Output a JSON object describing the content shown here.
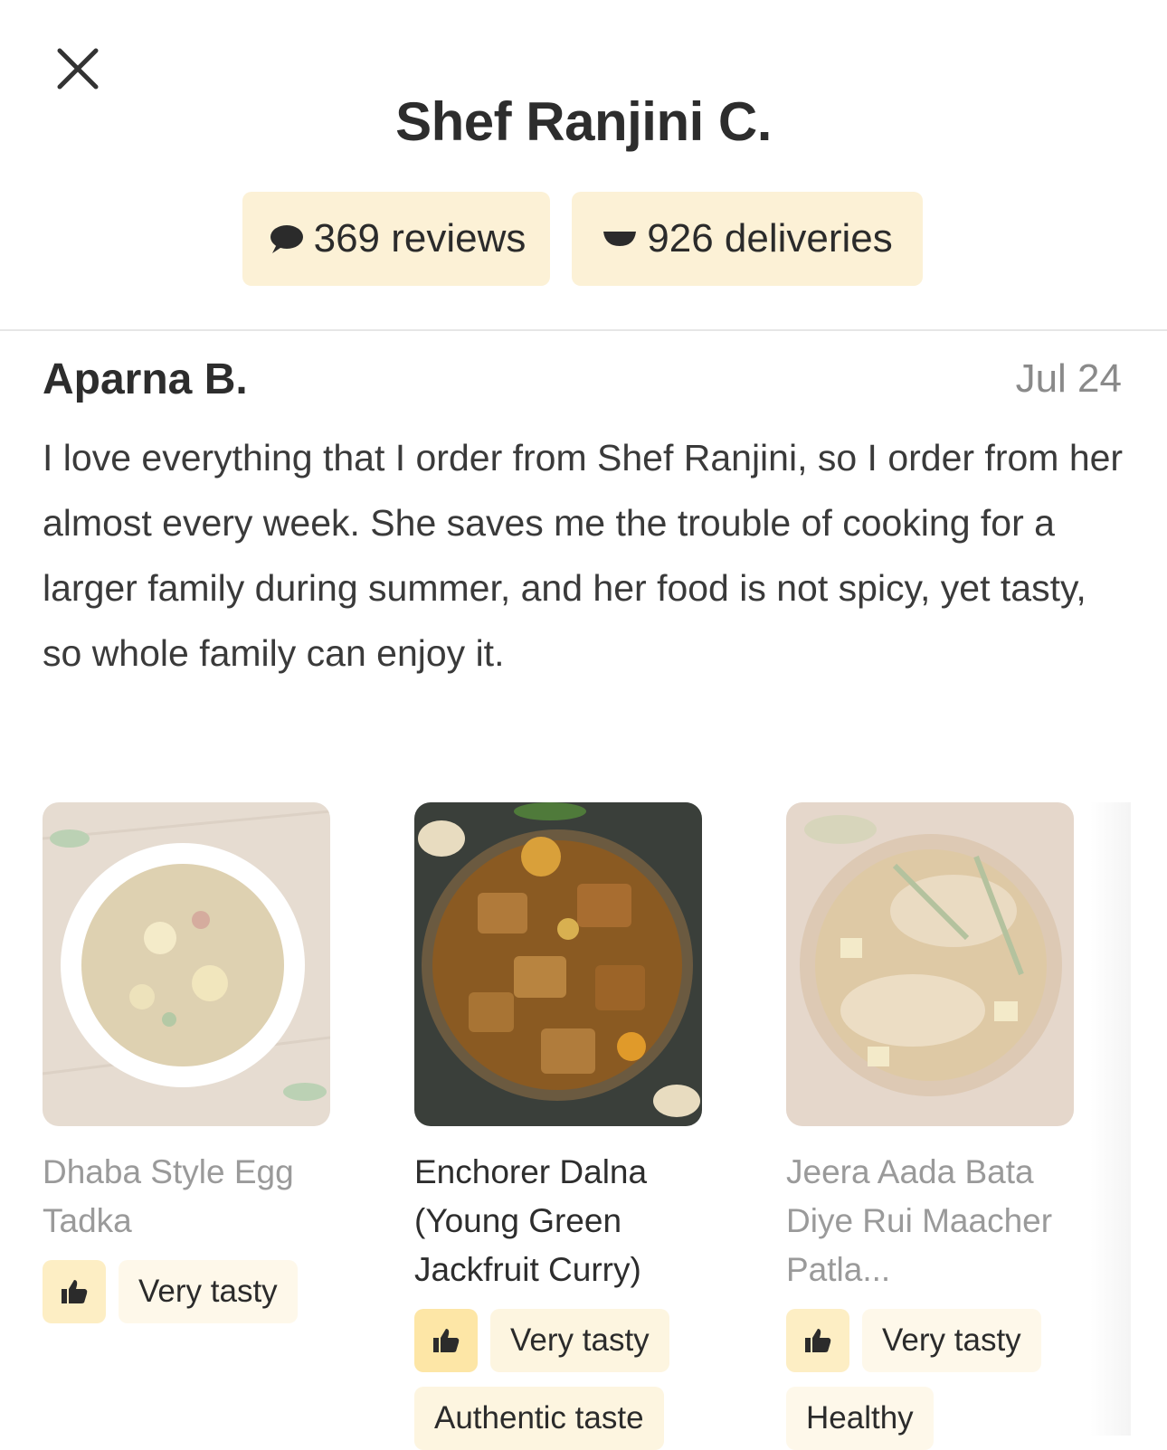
{
  "header": {
    "close_icon": "close-icon",
    "title": "Shef Ranjini C.",
    "reviews": "369 reviews",
    "deliveries": "926 deliveries"
  },
  "review": {
    "author": "Aparna B.",
    "date": "Jul 24",
    "text": "I love everything that I order from Shef Ranjini, so I order from her almost every week. She saves me the trouble of cooking for a larger family during summer, and her food is not spicy, yet tasty, so whole family can enjoy it."
  },
  "dishes": [
    {
      "name": "Dhaba Style Egg Tadka",
      "tags": [
        "Very tasty"
      ],
      "faded": true
    },
    {
      "name": "Enchorer Dalna (Young Green Jackfruit Curry)",
      "tags": [
        "Very tasty",
        "Authentic taste"
      ],
      "faded": false
    },
    {
      "name": "Jeera Aada Bata Diye Rui Maacher Patla...",
      "tags": [
        "Very tasty",
        "Healthy"
      ],
      "faded": true
    }
  ],
  "colors": {
    "badge_bg": "#fcf1d6",
    "thumb_bg": "#fde6a6",
    "tag_bg": "#fdf5e0",
    "muted_text": "#8a8a8a"
  }
}
